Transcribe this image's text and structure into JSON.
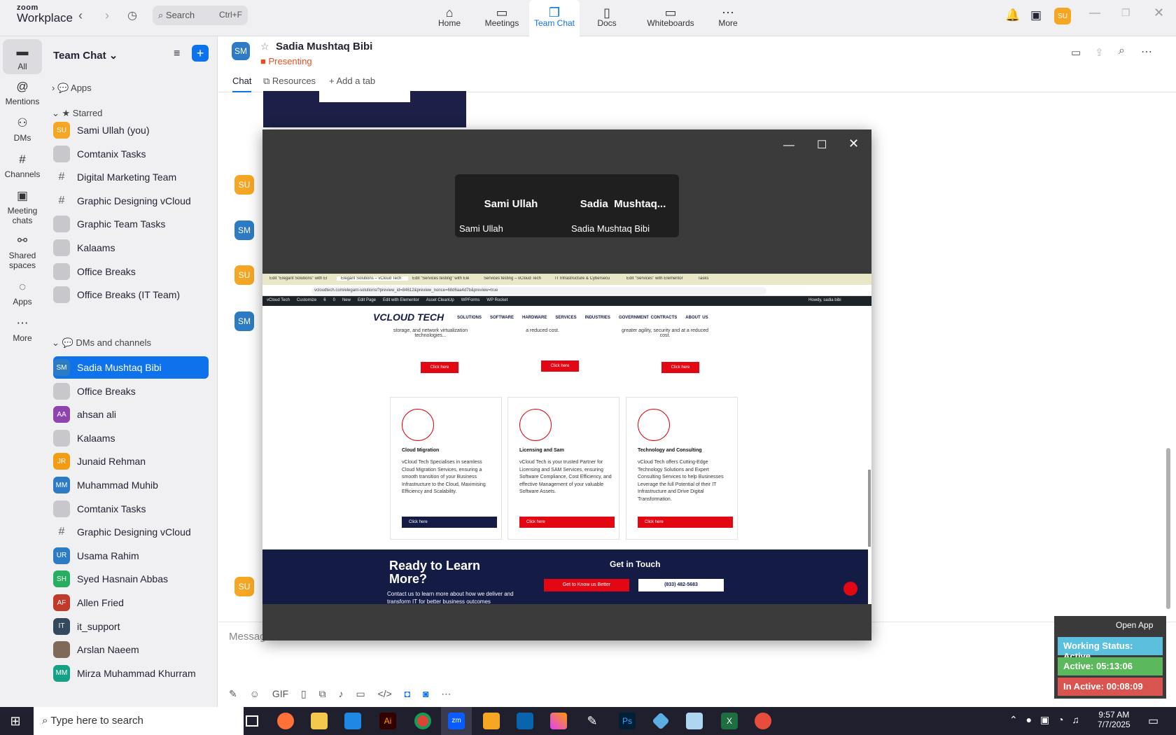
{
  "app": {
    "brand_top": "zoom",
    "brand_bottom": "Workplace",
    "search_placeholder": "Search",
    "search_shortcut": "Ctrl+F",
    "user_initials": "SU"
  },
  "nav": [
    {
      "label": "Home",
      "icon": "home-icon"
    },
    {
      "label": "Meetings",
      "icon": "video-icon"
    },
    {
      "label": "Team Chat",
      "icon": "chat-icon"
    },
    {
      "label": "Docs",
      "icon": "docs-icon"
    },
    {
      "label": "Whiteboards",
      "icon": "whiteboard-icon"
    },
    {
      "label": "More",
      "icon": "more-icon"
    }
  ],
  "rail": [
    {
      "label": "All"
    },
    {
      "label": "Mentions"
    },
    {
      "label": "DMs"
    },
    {
      "label": "Channels"
    },
    {
      "label": "Meeting chats"
    },
    {
      "label": "Shared spaces"
    },
    {
      "label": "Apps"
    },
    {
      "label": "More"
    }
  ],
  "sidebar": {
    "title": "Team Chat",
    "apps": "Apps",
    "starred_label": "Starred",
    "starred": [
      {
        "label": "Sami Ullah (you)",
        "initials": "SU",
        "color": "#f5a623"
      },
      {
        "label": "Comtanix Tasks",
        "initials": "",
        "color": "#c8c8cc"
      },
      {
        "label": "Digital Marketing Team",
        "initials": "#",
        "color": "#f0f0f2"
      },
      {
        "label": "Graphic Designing vCloud",
        "initials": "#",
        "color": "#f0f0f2"
      },
      {
        "label": "Graphic Team Tasks",
        "initials": "",
        "color": "#c8c8cc"
      },
      {
        "label": "Kalaams",
        "initials": "",
        "color": "#c8c8cc"
      },
      {
        "label": "Office Breaks",
        "initials": "",
        "color": "#c8c8cc"
      },
      {
        "label": "Office Breaks (IT Team)",
        "initials": "",
        "color": "#c8c8cc"
      }
    ],
    "dms_label": "DMs and channels",
    "dms": [
      {
        "label": "Sadia Mushtaq Bibi",
        "initials": "SM",
        "color": "#2d7bc4"
      },
      {
        "label": "Office Breaks",
        "initials": "",
        "color": "#c8c8cc"
      },
      {
        "label": "ahsan ali",
        "initials": "AA",
        "color": "#8e44ad"
      },
      {
        "label": "Kalaams",
        "initials": "",
        "color": "#c8c8cc"
      },
      {
        "label": "Junaid Rehman",
        "initials": "JR",
        "color": "#f39c12"
      },
      {
        "label": "Muhammad Muhib",
        "initials": "MM",
        "color": "#2d7bc4"
      },
      {
        "label": "Comtanix Tasks",
        "initials": "",
        "color": "#c8c8cc"
      },
      {
        "label": "Graphic Designing vCloud",
        "initials": "#",
        "color": "#f0f0f2"
      },
      {
        "label": "Usama Rahim",
        "initials": "UR",
        "color": "#2d7bc4"
      },
      {
        "label": "Syed Hasnain Abbas",
        "initials": "SH",
        "color": "#27ae60"
      },
      {
        "label": "Allen Fried",
        "initials": "AF",
        "color": "#c0392b"
      },
      {
        "label": "it_support",
        "initials": "IT",
        "color": "#34495e"
      },
      {
        "label": "Arslan Naeem",
        "initials": "",
        "color": "#7f6a5a"
      },
      {
        "label": "Mirza Muhammad Khurram",
        "initials": "MM",
        "color": "#16a085"
      }
    ]
  },
  "chat": {
    "name": "Sadia Mushtaq Bibi",
    "initials": "SM",
    "status": "Presenting",
    "tabs": [
      "Chat",
      "Resources",
      "Add a tab"
    ],
    "message_placeholder": "Message",
    "avatars": [
      "SU",
      "SM",
      "SU",
      "SM",
      "SU"
    ]
  },
  "meeting": {
    "participants": [
      {
        "name": "Sami Ullah",
        "label": "Sami Ullah"
      },
      {
        "name": "Sadia  Mushtaq...",
        "label": "Sadia Mushtaq Bibi"
      }
    ]
  },
  "shared_screen": {
    "browser_tabs": [
      "Edit \"Elegant Solutions\" with El",
      "Elegant Solutions – vCloud Tech",
      "Edit \"Services testing\" with Ele",
      "Services testing – vCloud Tech",
      "IT Infrastructure & Cybersecu",
      "Edit \"Services\" with Elementor",
      "Tasks"
    ],
    "url": "vcloudtech.com/elegant-solutions/?preview_id=84612&preview_nonce=68d6aa4d7b&preview=true",
    "wp_bar": [
      "vCloud Tech",
      "Customize",
      "6",
      "0",
      "New",
      "Edit Page",
      "Edit with Elementor",
      "Asset CleanUp",
      "WPForms",
      "WP Rocket"
    ],
    "wp_user": "Howdy, sadia bibi",
    "logo": "VCLOUD TECH",
    "site_nav": [
      "SOLUTIONS",
      "SOFTWARE",
      "HARDWARE",
      "SERVICES",
      "INDUSTRIES",
      "GOVERNMENT CONTRACTS",
      "ABOUT US"
    ],
    "top_texts": [
      "storage, and network virtualization technologies...",
      "a reduced cost.",
      "greater agility, security and at a reduced cost."
    ],
    "click_here": "Click here",
    "cards": [
      {
        "title": "Cloud Migration",
        "body": "vCloud Tech Specialises in seamless Cloud Migration Services, ensuring a smooth transition of your Business Infrastructure to the Cloud, Maximising Efficiency and Scalability."
      },
      {
        "title": "Licensing and Sam",
        "body": "vCloud Tech is your trusted Partner for Licensing and SAM Services, ensuring Software Compliance, Cost Efficiency, and effective Management of your valuable Software Assets."
      },
      {
        "title": "Technology and Consulting",
        "body": "vCloud Tech offers Cutting-Edge Technology Solutions and Expert Consulting Services to help Businesses Leverage the full Potential of their IT Infrastructure and Drive Digital Transformation."
      }
    ],
    "footer_title": "Ready to Learn More?",
    "footer_body": "Contact us to learn more about how we deliver and transform IT for better business outcomes",
    "get_in_touch": "Get in Touch",
    "know_us": "Get to Know us Better",
    "phone": "(833) 482-5683"
  },
  "tracker": {
    "open_app": "Open App",
    "working": "Working Status: Active",
    "active": "Active: 05:13:06",
    "inactive": "In Active: 00:08:09"
  },
  "taskbar": {
    "search": "Type here to search",
    "time": "9:57 AM",
    "date": "7/7/2025"
  },
  "colors": {
    "accent": "#0e72ed",
    "presenting": "#e8501f",
    "site_red": "#e30613",
    "site_navy": "#141b45"
  }
}
